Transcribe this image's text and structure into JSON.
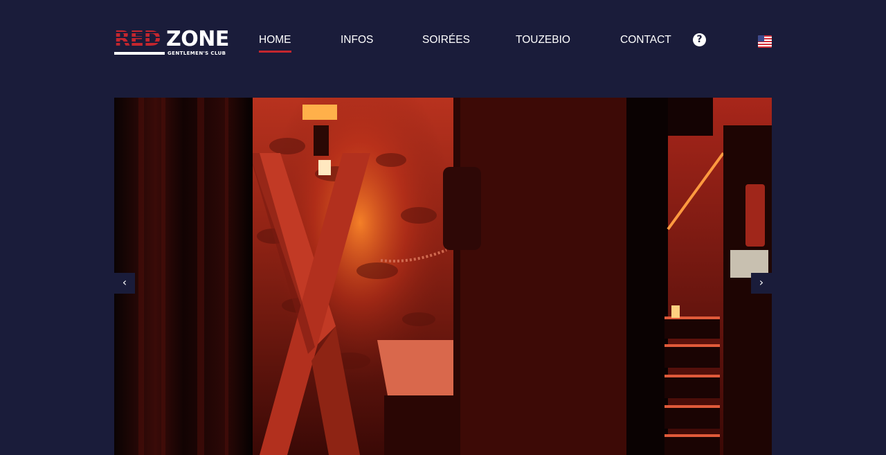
{
  "brand": {
    "logo_red": "RED",
    "logo_white": "ZONE",
    "logo_sub": "GENTLEMEN'S CLUB"
  },
  "nav": {
    "items": [
      {
        "label": "HOME",
        "active": true
      },
      {
        "label": "INFOS",
        "active": false
      },
      {
        "label": "SOIRÉES",
        "active": false
      },
      {
        "label": "TOUZEBIO",
        "active": false
      },
      {
        "label": "CONTACT",
        "active": false
      }
    ],
    "help_symbol": "?",
    "language_icon": "us-flag-icon"
  },
  "slider": {
    "prev_symbol": "‹",
    "next_symbol": "›",
    "image_description_icon": "dungeon-photo"
  },
  "colors": {
    "background": "#1a1c3a",
    "accent": "#c4262e",
    "text": "#ffffff"
  }
}
